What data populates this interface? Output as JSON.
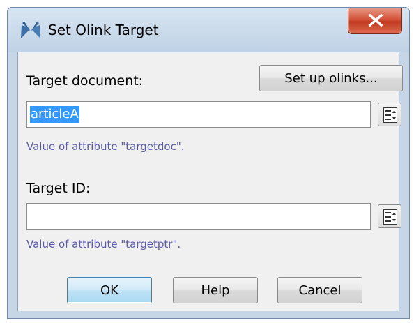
{
  "dialog": {
    "title": "Set Olink Target",
    "close_symbol": "X"
  },
  "target_document": {
    "label": "Target document:",
    "value": "articleA",
    "hint": "Value of attribute \"targetdoc\".",
    "setup_button": "Set up olinks..."
  },
  "target_id": {
    "label": "Target ID:",
    "value": "",
    "hint": "Value of attribute \"targetptr\"."
  },
  "buttons": {
    "ok": "OK",
    "help": "Help",
    "cancel": "Cancel"
  },
  "icons": {
    "app": "olink-cross-icon",
    "picker": "list-picker-icon",
    "close": "close-icon"
  }
}
